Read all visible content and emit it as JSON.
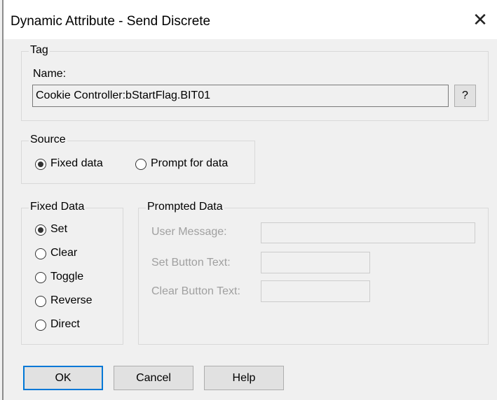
{
  "window": {
    "title": "Dynamic Attribute - Send Discrete",
    "close_glyph": "✕"
  },
  "tag": {
    "group_label": "Tag",
    "name_label": "Name:",
    "name_value": "Cookie Controller:bStartFlag.BIT01",
    "browse_label": "?"
  },
  "source": {
    "group_label": "Source",
    "options": [
      {
        "label": "Fixed data",
        "selected": true
      },
      {
        "label": "Prompt for data",
        "selected": false
      }
    ]
  },
  "fixed_data": {
    "group_label": "Fixed Data",
    "options": [
      {
        "label": "Set",
        "selected": true
      },
      {
        "label": "Clear",
        "selected": false
      },
      {
        "label": "Toggle",
        "selected": false
      },
      {
        "label": "Reverse",
        "selected": false
      },
      {
        "label": "Direct",
        "selected": false
      }
    ]
  },
  "prompted_data": {
    "group_label": "Prompted Data",
    "user_message_label": "User Message:",
    "set_button_text_label": "Set Button Text:",
    "clear_button_text_label": "Clear Button Text:",
    "user_message_value": "",
    "set_button_text_value": "",
    "clear_button_text_value": ""
  },
  "buttons": {
    "ok": "OK",
    "cancel": "Cancel",
    "help": "Help"
  }
}
